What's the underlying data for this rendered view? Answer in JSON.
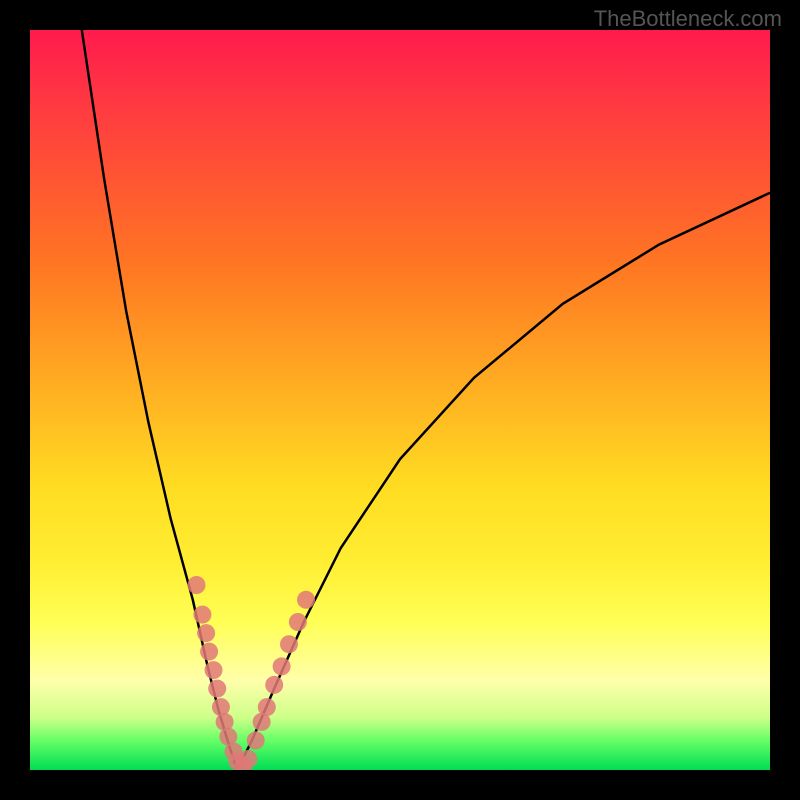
{
  "watermark": "TheBottleneck.com",
  "chart_data": {
    "type": "line",
    "title": "",
    "xlabel": "",
    "ylabel": "",
    "xlim": [
      0,
      100
    ],
    "ylim": [
      0,
      100
    ],
    "description": "V-shaped bottleneck curve on rainbow gradient background (red=high bottleneck, green=low bottleneck)",
    "curve_left": {
      "x": [
        7,
        10,
        13,
        16,
        19,
        22,
        24,
        25.5,
        27,
        28
      ],
      "y": [
        100,
        80,
        62,
        47,
        34,
        23,
        14,
        8,
        3,
        0
      ]
    },
    "curve_right": {
      "x": [
        28,
        30,
        33,
        37,
        42,
        50,
        60,
        72,
        85,
        100
      ],
      "y": [
        0,
        4,
        11,
        20,
        30,
        42,
        53,
        63,
        71,
        78
      ]
    },
    "series": [
      {
        "name": "left-branch-markers",
        "x": [
          22.5,
          23.3,
          23.8,
          24.2,
          24.8,
          25.3,
          25.8,
          26.3,
          26.8,
          27.5,
          28.0,
          28.8
        ],
        "y": [
          25,
          21,
          18.5,
          16,
          13.5,
          11,
          8.5,
          6.5,
          4.5,
          2.5,
          1.2,
          0.5
        ]
      },
      {
        "name": "right-branch-markers",
        "x": [
          29.5,
          30.5,
          31.3,
          32.0,
          33.0,
          34.0,
          35.0,
          36.2,
          37.3
        ],
        "y": [
          1.5,
          4,
          6.5,
          8.5,
          11.5,
          14,
          17,
          20,
          23
        ]
      }
    ]
  }
}
